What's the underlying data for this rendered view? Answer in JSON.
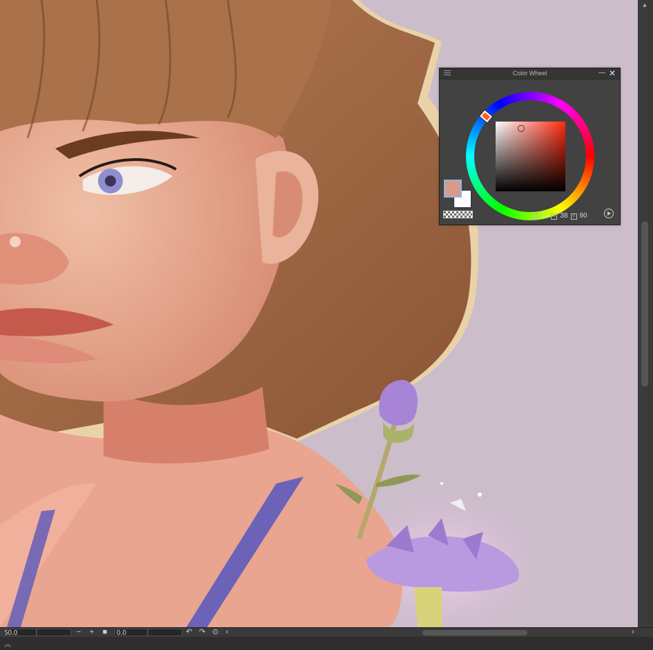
{
  "color_wheel": {
    "title": "Color Wheel",
    "main_color": "#d99a8a",
    "sub_color": "#ffffff",
    "hue": "11",
    "saturation": "38",
    "value": "90",
    "hue_label_icon": "hue-icon",
    "saturation_label_icon": "saturation-icon",
    "value_label_icon": "value-icon"
  },
  "status_bar": {
    "zoom": "50.0",
    "rotation": "0.0",
    "zoom_out_label": "−",
    "zoom_in_label": "+",
    "fit_label": "■",
    "undo_label": "↶",
    "redo_label": "↷",
    "reset_rotation_label": "⊙",
    "scroll_left_label": "‹",
    "scroll_right_label": "›"
  },
  "colors": {
    "panel_bg": "#424242",
    "canvas_bg": "#c9b9c8"
  }
}
